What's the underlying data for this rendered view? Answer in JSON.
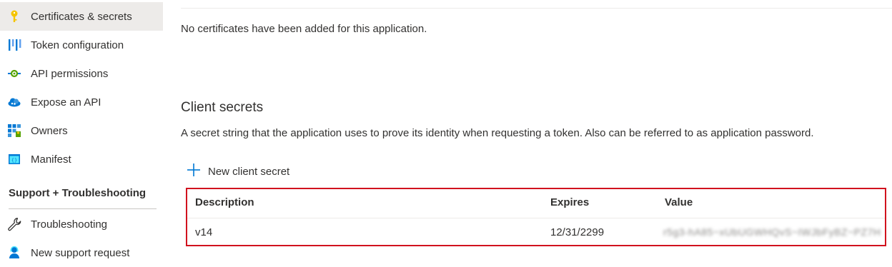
{
  "sidebar": {
    "items": [
      {
        "label": "Certificates & secrets",
        "icon": "key-icon"
      },
      {
        "label": "Token configuration",
        "icon": "token-config-icon"
      },
      {
        "label": "API permissions",
        "icon": "api-permissions-icon"
      },
      {
        "label": "Expose an API",
        "icon": "cloud-icon"
      },
      {
        "label": "Owners",
        "icon": "owners-grid-icon"
      },
      {
        "label": "Manifest",
        "icon": "manifest-icon"
      }
    ],
    "support_header": "Support + Troubleshooting",
    "support_items": [
      {
        "label": "Troubleshooting",
        "icon": "wrench-icon"
      },
      {
        "label": "New support request",
        "icon": "support-person-icon"
      }
    ]
  },
  "certificates": {
    "empty_message": "No certificates have been added for this application."
  },
  "client_secrets": {
    "title": "Client secrets",
    "description": "A secret string that the application uses to prove its identity when requesting a token. Also can be referred to as application password.",
    "new_button_label": "New client secret",
    "table": {
      "headers": [
        "Description",
        "Expires",
        "Value"
      ],
      "rows": [
        {
          "description": "v14",
          "expires": "12/31/2299",
          "value": "r5g3-hA85~xUbUGWHQvS~IWJbFyBZ~PZ7H"
        }
      ]
    }
  },
  "colors": {
    "accent": "#0078d4",
    "highlight_border": "#d1121e",
    "active_bg": "#edebe9"
  }
}
